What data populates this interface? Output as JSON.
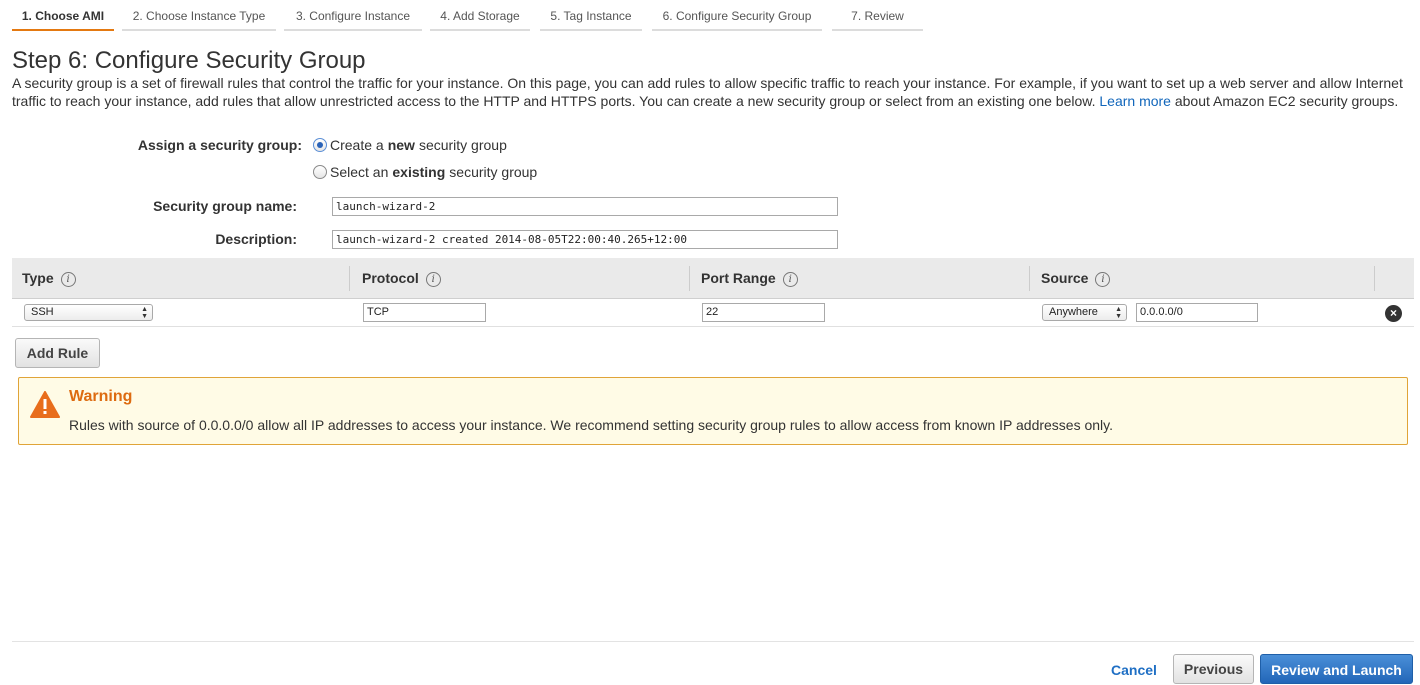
{
  "wizard": {
    "tabs": [
      {
        "label": "1. Choose AMI"
      },
      {
        "label": "2. Choose Instance Type"
      },
      {
        "label": "3. Configure Instance"
      },
      {
        "label": "4. Add Storage"
      },
      {
        "label": "5. Tag Instance"
      },
      {
        "label": "6. Configure Security Group"
      },
      {
        "label": "7. Review"
      }
    ],
    "active_tab": "1. Choose AMI"
  },
  "page": {
    "title": "Step 6: Configure Security Group",
    "intro_before_link": "A security group is a set of firewall rules that control the traffic for your instance. On this page, you can add rules to allow specific traffic to reach your instance. For example, if you want to set up a web server and allow Internet traffic to reach your instance, add rules that allow unrestricted access to the HTTP and HTTPS ports. You can create a new security group or select from an existing one below.",
    "intro_link": "Learn more",
    "intro_after_link": "about Amazon EC2 security groups."
  },
  "assign": {
    "label": "Assign a security group:",
    "option_new": {
      "prefix": "Create a ",
      "emphasis": "new",
      "suffix": " security group",
      "selected": true
    },
    "option_existing": {
      "prefix": "Select an ",
      "emphasis": "existing",
      "suffix": " security group",
      "selected": false
    }
  },
  "group_name": {
    "label": "Security group name:",
    "value": "launch-wizard-2"
  },
  "description": {
    "label": "Description:",
    "value": "launch-wizard-2 created 2014-08-05T22:00:40.265+12:00"
  },
  "rules_table": {
    "columns": [
      "Type",
      "Protocol",
      "Port Range",
      "Source"
    ],
    "info_icon": "i",
    "rows": [
      {
        "type": "SSH",
        "protocol": "TCP",
        "port_range": "22",
        "source_select": "Anywhere",
        "source_cidr": "0.0.0.0/0",
        "remove_icon": "×"
      }
    ]
  },
  "add_rule_label": "Add Rule",
  "warning": {
    "title": "Warning",
    "text": "Rules with source of 0.0.0.0/0 allow all IP addresses to access your instance. We recommend setting security group rules to allow access from known IP addresses only.",
    "icon": "warning-triangle-icon",
    "accent_color": "#dd6b10"
  },
  "footer": {
    "cancel_label": "Cancel",
    "previous_label": "Previous",
    "review_label": "Review and Launch"
  },
  "colors": {
    "primary": "#2266b8",
    "link": "#1166bb",
    "active_tab": "#e47911",
    "warning_bg": "#fffbe6",
    "warning_border": "#e0a438"
  }
}
